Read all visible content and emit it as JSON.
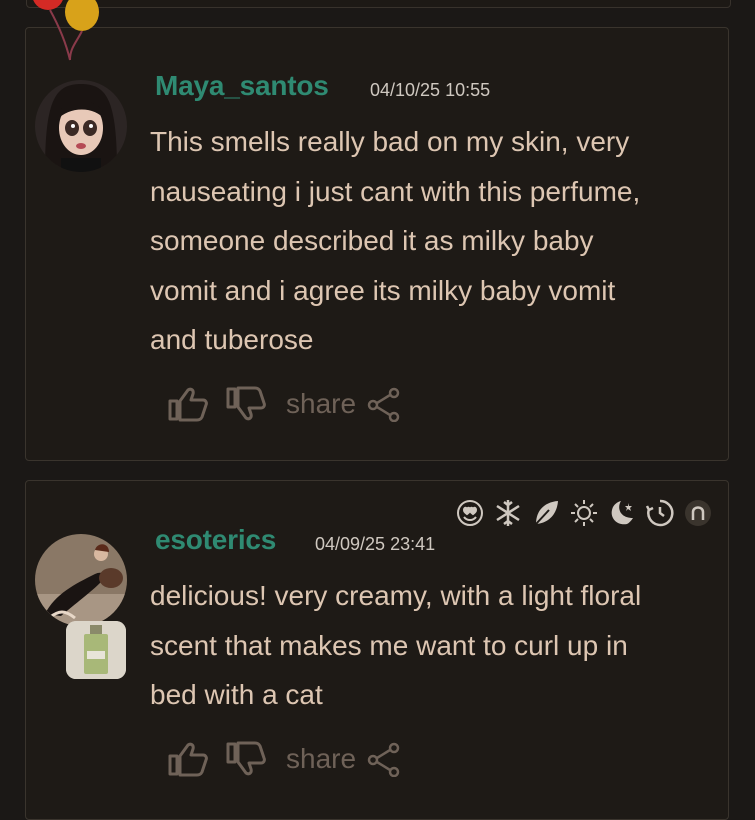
{
  "comments": [
    {
      "username": "Maya_santos",
      "timestamp": "04/10/25 10:55",
      "lines": [
        "This smells really bad on my skin, very",
        "nauseating i just cant with this perfume,",
        "someone described it as milky baby",
        "vomit and i agree its milky baby vomit",
        "and tuberose"
      ],
      "avatar_icon": "doll-avatar",
      "decoration_icon": "balloons-icon",
      "actions": {
        "like_icon": "thumbs-up-icon",
        "dislike_icon": "thumbs-down-icon",
        "share_label": "share",
        "share_icon": "share-icon"
      }
    },
    {
      "username": "esoterics",
      "timestamp": "04/09/25 23:41",
      "lines": [
        "delicious! very creamy, with a light floral",
        "scent that makes me want to curl up in",
        "bed with a cat"
      ],
      "avatar_icon": "person-with-cat-avatar",
      "badge_icon": "perfume-bottle-thumbnail",
      "season_icons": [
        "love-icon",
        "winter-icon",
        "spring-icon",
        "summer-icon",
        "night-icon",
        "day-icon",
        "fall-icon"
      ],
      "actions": {
        "like_icon": "thumbs-up-icon",
        "dislike_icon": "thumbs-down-icon",
        "share_label": "share",
        "share_icon": "share-icon"
      }
    }
  ],
  "colors": {
    "background": "#1b1816",
    "card": "#1e1a16",
    "username": "#2f8a72",
    "text": "#ddc6b2",
    "muted": "#6f6258"
  }
}
